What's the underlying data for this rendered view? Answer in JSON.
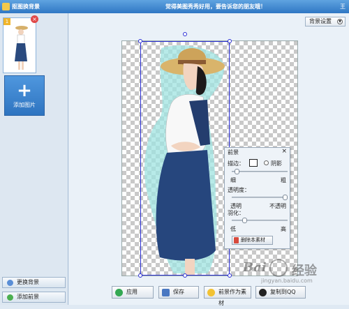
{
  "window": {
    "title": "抠图换背景",
    "marquee": "觉得美图秀秀好用，要告诉您的朋友哦！",
    "edge_text": "王"
  },
  "left_panel": {
    "thumb_index": "1",
    "add_picture_label": "添加图片",
    "change_bg_label": "更换背景",
    "add_fg_label": "添加前景"
  },
  "toolbar": {
    "bg_settings_label": "背景设置"
  },
  "float_panel": {
    "title": "前景",
    "edge_label": "描边：",
    "shadow_label": "阴影",
    "edge_thin": "细",
    "edge_thick": "粗",
    "edge_value": 0.05,
    "opacity_label": "透明度：",
    "opacity_left": "透明",
    "opacity_right": "不透明",
    "opacity_value": 1.0,
    "feather_label": "羽化：",
    "feather_low": "低",
    "feather_high": "高",
    "feather_value": 0.2,
    "delete_label": "删除本素材"
  },
  "actions": {
    "apply": "应用",
    "save": "保存",
    "save_as_material": "前景作为素材",
    "copy_to_qq": "复制到QQ"
  },
  "watermark": {
    "brand_text": "Bai",
    "brand_cn": "经验",
    "url": "jingyan.baidu.com"
  },
  "colors": {
    "titlebar": "#3a85d0",
    "selection": "#2c30d6",
    "add_button": "#3d86d3"
  }
}
